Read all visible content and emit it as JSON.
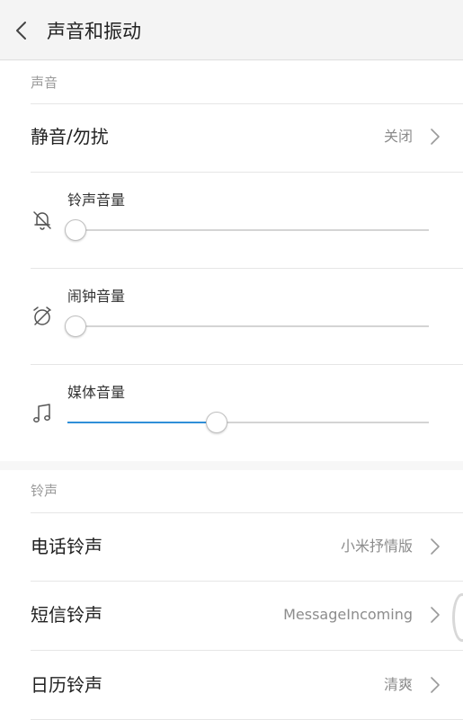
{
  "header": {
    "title": "声音和振动",
    "back_icon": "chevron-left-icon"
  },
  "sound_section": {
    "label": "声音",
    "dnd": {
      "label": "静音/勿扰",
      "value": "关闭"
    },
    "volumes": [
      {
        "label": "铃声音量",
        "icon": "bell-off-icon",
        "level": 0
      },
      {
        "label": "闹钟音量",
        "icon": "alarm-off-icon",
        "level": 0
      },
      {
        "label": "媒体音量",
        "icon": "music-note-icon",
        "level": 0.4
      }
    ]
  },
  "ringtone_section": {
    "label": "铃声",
    "items": [
      {
        "label": "电话铃声",
        "value": "小米抒情版"
      },
      {
        "label": "短信铃声",
        "value": "MessageIncoming"
      },
      {
        "label": "日历铃声",
        "value": "清爽"
      }
    ]
  },
  "colors": {
    "accent": "#2f8fd8",
    "track": "#d4d4d4",
    "background": "#f7f7f7"
  }
}
